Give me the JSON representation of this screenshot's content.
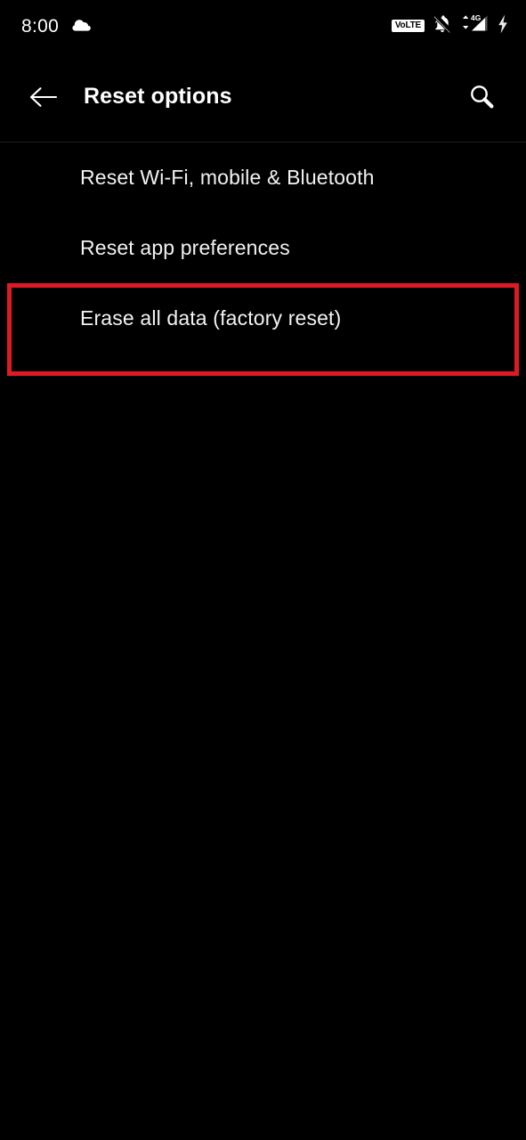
{
  "status_bar": {
    "time": "8:00",
    "left_icons": [
      {
        "name": "cloud-icon",
        "label": "cloud"
      }
    ],
    "right_icons": [
      {
        "name": "volte-badge",
        "label": "VoLTE"
      },
      {
        "name": "notifications-off-icon",
        "label": "notifications silenced"
      },
      {
        "name": "mobile-signal-4g-icon",
        "label": "4G"
      },
      {
        "name": "battery-charging-icon",
        "label": "charging"
      }
    ],
    "volte_text": "VoLTE",
    "network_type": "4G"
  },
  "app_bar": {
    "back_label": "Back",
    "title": "Reset options",
    "search_label": "Search"
  },
  "main": {
    "items": [
      {
        "label": "Reset Wi-Fi, mobile & Bluetooth"
      },
      {
        "label": "Reset app preferences"
      },
      {
        "label": "Erase all data (factory reset)"
      }
    ]
  },
  "annotation": {
    "highlight_color": "#de1b24",
    "highlighted_item": "Erase all data (factory reset)"
  },
  "theme": {
    "background": "#000000",
    "text_primary": "#ffffff",
    "text_secondary": "#f2f2f2",
    "divider": "#1e1e1e"
  }
}
